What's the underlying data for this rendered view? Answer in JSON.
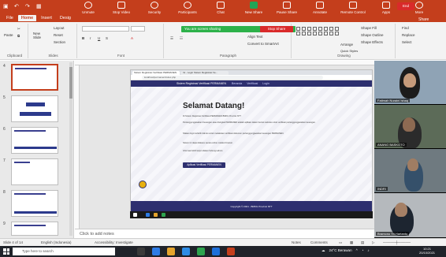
{
  "ribbon": {
    "tabs": [
      "File",
      "Home",
      "Insert",
      "Desig"
    ],
    "active_tab": "Home",
    "groups": [
      "Clipboard",
      "Slides",
      "Font",
      "Paragraph",
      "Drawing"
    ],
    "buttons": {
      "paste": "Paste",
      "new_slide": "New Slide",
      "layout": "Layout",
      "reset": "Reset",
      "section": "Section",
      "align_text": "Align Text",
      "convert_smartart": "Convert to SmartArt",
      "arrange": "Arrange",
      "quick_styles": "Quick Styles",
      "shape_fill": "Shape Fill",
      "shape_outline": "Shape Outline",
      "shape_effects": "Shape Effects",
      "find": "Find",
      "replace": "Replace",
      "select": "Select"
    },
    "share": "Share"
  },
  "meeting": {
    "controls": [
      "Unmute",
      "Stop Video",
      "Security",
      "Participants",
      "Chat",
      "New Share",
      "Pause Share",
      "Annotate",
      "Remote Control",
      "Apps",
      "More"
    ],
    "participants_count": "21",
    "end": "End",
    "sharing_text": "You are screen sharing",
    "stop_share": "Stop Share"
  },
  "thumbnails": {
    "numbers": [
      "4",
      "5",
      "6",
      "7",
      "8",
      "9"
    ],
    "active": "4"
  },
  "slide": {
    "browser_tabs": [
      "Sistem Registrasi Verifikasi PERMANEN",
      "Ini - Login Sistem Registrasi Ve..."
    ],
    "url": "localhost/permanen/index.php",
    "site_brand": "Sistem Registrasi Verifikasi PERMANEN",
    "nav_links": [
      "Beranda",
      "Verifikasi",
      "Login"
    ],
    "welcome": "Selamat Datang!",
    "para1": "Di Sistem Registrasi Verifikasi PERMANEN BMKG Provinsi NTT",
    "para2": "Pertanggungjawaban Keuangan atau disingkat PERMANEN adalah aplikasi dalam bentuk website untuk verifikasi pertanggungjawaban keuangan.",
    "para3": "Silakan login terlebih dahulu untuk melakukan verifikasi dokumen pertanggungjawaban keuangan PERMANEN.",
    "para4": "Sistem ini dapat diakses secara online melalui browser.",
    "para5": "Informasi lebih lanjut silakan hubungi admin.",
    "cta": "Aplikasi Verifikasi PERMANEN",
    "footer": "Copyright © 2021 - BMKG Provinsi NTT"
  },
  "notes_placeholder": "Click to add notes",
  "participants": [
    {
      "name": "Fatimah Nuraini Ishaq"
    },
    {
      "name": "ANANG BASKOTO"
    },
    {
      "name": "INDRI"
    },
    {
      "name": "Bramono Tri Hartanto"
    }
  ],
  "status_bar": {
    "slide_info": "Slide 4 of 14",
    "language": "English (Indonesia)",
    "accessibility": "Accessibility: Investigate",
    "notes": "Notes",
    "comments": "Comments"
  },
  "taskbar": {
    "search_placeholder": "Type here to search",
    "weather": "24°C Berawan",
    "time": "10:21",
    "date": "20/10/2021"
  },
  "colors": {
    "ribbon": "#c43e1c",
    "sharing_green": "#2db14a",
    "stop_red": "#d92a2a",
    "site_navy": "#2d2f6f"
  }
}
